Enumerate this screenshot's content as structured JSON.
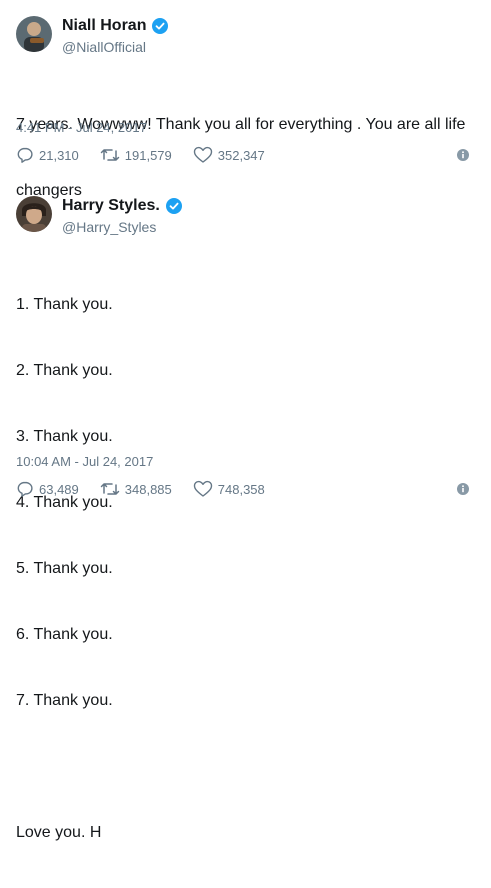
{
  "tweets": [
    {
      "name": "Niall Horan",
      "handle": "@NiallOfficial",
      "verified": true,
      "lines": [
        "7 years. Wowwww! Thank you all for everything . You are all life",
        "changers"
      ],
      "timestamp": "4:41 PM - Jul 24, 2017",
      "replies": "21,310",
      "retweets": "191,579",
      "likes": "352,347"
    },
    {
      "name": "Harry Styles.",
      "handle": "@Harry_Styles",
      "verified": true,
      "lines": [
        "1. Thank you.",
        "2. Thank you.",
        "3. Thank you.",
        "4. Thank you.",
        "5. Thank you.",
        "6. Thank you.",
        "7. Thank you.",
        "",
        "Love you. H"
      ],
      "timestamp": "10:04 AM - Jul 24, 2017",
      "replies": "63,489",
      "retweets": "348,885",
      "likes": "748,358"
    }
  ],
  "colors": {
    "verified": "#1da1f2",
    "secondary_text": "#657786",
    "primary_text": "#14171a"
  },
  "icons": [
    "reply-icon",
    "retweet-icon",
    "like-icon",
    "info-icon",
    "verified-badge-icon"
  ]
}
